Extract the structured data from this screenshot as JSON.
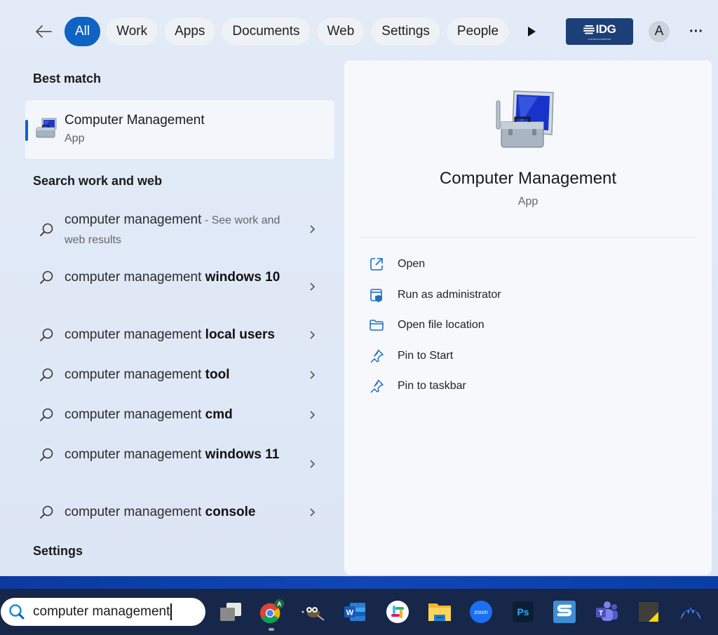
{
  "filter_bar": {
    "back_label": "Back",
    "chips": [
      {
        "label": "All",
        "active": true
      },
      {
        "label": "Work",
        "active": false
      },
      {
        "label": "Apps",
        "active": false
      },
      {
        "label": "Documents",
        "active": false
      },
      {
        "label": "Web",
        "active": false
      },
      {
        "label": "Settings",
        "active": false
      },
      {
        "label": "People",
        "active": false
      }
    ],
    "org_logo_text": "IDG",
    "org_logo_subtext": "communications",
    "avatar_initial": "A",
    "more_label": "···"
  },
  "results": {
    "best_match_header": "Best match",
    "best_match": {
      "name": "Computer Management",
      "type": "App"
    },
    "web_header": "Search work and web",
    "suggestions": [
      {
        "prefix": "computer management",
        "bold": "",
        "hint": " - See work and web results"
      },
      {
        "prefix": "computer management ",
        "bold": "windows 10",
        "hint": ""
      },
      {
        "prefix": "computer management ",
        "bold": "local users",
        "hint": ""
      },
      {
        "prefix": "computer management ",
        "bold": "tool",
        "hint": ""
      },
      {
        "prefix": "computer management ",
        "bold": "cmd",
        "hint": ""
      },
      {
        "prefix": "computer management ",
        "bold": "windows 11",
        "hint": ""
      },
      {
        "prefix": "computer management ",
        "bold": "console",
        "hint": ""
      }
    ],
    "settings_header": "Settings"
  },
  "details": {
    "title": "Computer Management",
    "subtitle": "App",
    "actions": [
      {
        "label": "Open",
        "icon": "open-external-icon"
      },
      {
        "label": "Run as administrator",
        "icon": "shield-window-icon"
      },
      {
        "label": "Open file location",
        "icon": "folder-icon"
      },
      {
        "label": "Pin to Start",
        "icon": "pin-icon"
      },
      {
        "label": "Pin to taskbar",
        "icon": "pin-icon"
      }
    ]
  },
  "taskbar": {
    "search_value": "computer management",
    "chrome_profile_initial": "A",
    "zoom_label": "zoom",
    "photoshop_label": "Ps",
    "word_label": "W",
    "teams_label": "T",
    "apps": [
      "Task View",
      "Google Chrome",
      "GIMP",
      "Microsoft Word",
      "Slack",
      "File Explorer",
      "Zoom",
      "Adobe Photoshop",
      "Snagit",
      "Microsoft Teams",
      "Sticky Notes",
      "NordVPN"
    ]
  },
  "colors": {
    "accent": "#0f63c4",
    "taskbar": "#172749",
    "idg_bg": "#1c3f77"
  }
}
